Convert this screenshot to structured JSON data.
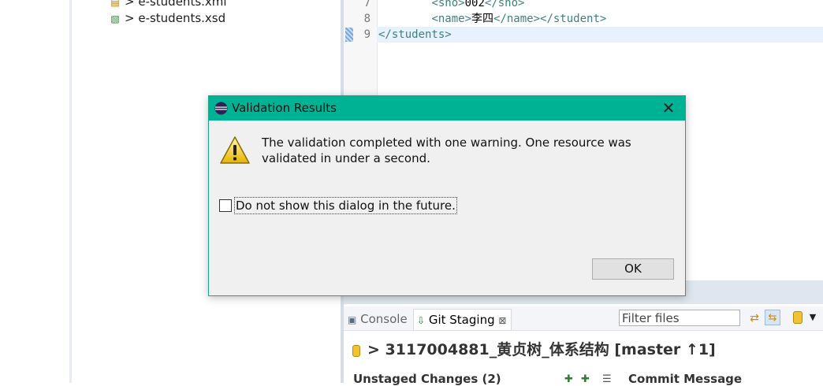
{
  "explorer": {
    "items": [
      {
        "label": "> e-students.xml",
        "icon": "xml-file-icon"
      },
      {
        "label": "> e-students.xsd",
        "icon": "xsd-file-icon"
      }
    ]
  },
  "editor": {
    "lines": [
      {
        "num": "7",
        "indent": "        ",
        "open": "<sno>",
        "text": "002",
        "close": "</sno>"
      },
      {
        "num": "8",
        "indent": "        ",
        "open": "<name>",
        "text": "李四",
        "close": "</name></student>"
      },
      {
        "num": "9",
        "indent": "",
        "open": "</students>",
        "text": "",
        "close": ""
      }
    ]
  },
  "dialog": {
    "title": "Validation Results",
    "close_glyph": "✕",
    "message": "The validation completed with one warning. One resource was validated in under a second.",
    "checkbox_label": "Do not show this dialog in the future.",
    "checkbox_checked": false,
    "ok_label": "OK"
  },
  "bottom": {
    "tabs": {
      "console": "Console",
      "git_staging": "Git Staging",
      "close_glyph": "⊠"
    },
    "filter_placeholder": "Filter files",
    "repo_title": "> 3117004881_黄贞树_体系结构 [master ↑1]",
    "unstaged_header": "Unstaged Changes (2)",
    "commit_header": "Commit Message"
  },
  "colors": {
    "dialog_titlebar": "#00b294",
    "xml_tag": "#3f7f7f",
    "current_line": "#e8f2fe"
  }
}
